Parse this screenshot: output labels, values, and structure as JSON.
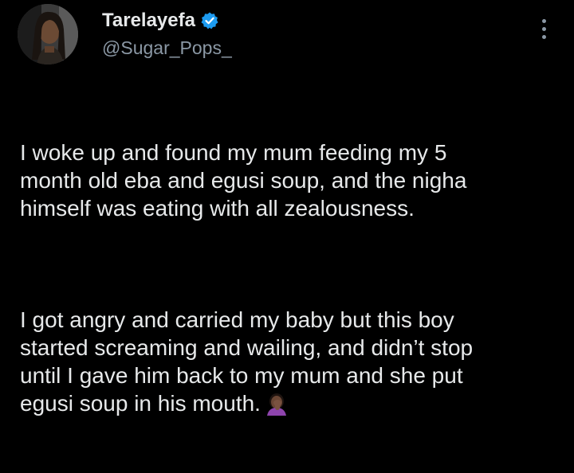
{
  "author": {
    "display_name": "Tarelayefa",
    "handle": "@Sugar_Pops_",
    "avatar_icon": "profile-photo",
    "verified_icon": "verified-badge-icon",
    "verified_color": "#1d9bf0"
  },
  "menu": {
    "icon": "more-options-icon"
  },
  "tweet": {
    "paragraphs": [
      "I woke up and found my mum feeding my 5\nmonth old eba and egusi soup, and the nigha\nhimself was eating with all zealousness.",
      "I got angry and carried my baby but this boy\nstarted screaming and wailing, and didn’t stop\nuntil I gave him back to my mum and she put\negusi soup in his mouth."
    ],
    "trailing_emoji": "facepalm-emoji"
  },
  "colors": {
    "background": "#000000",
    "text": "#e7e9ea",
    "secondary_text": "#8b98a5"
  }
}
